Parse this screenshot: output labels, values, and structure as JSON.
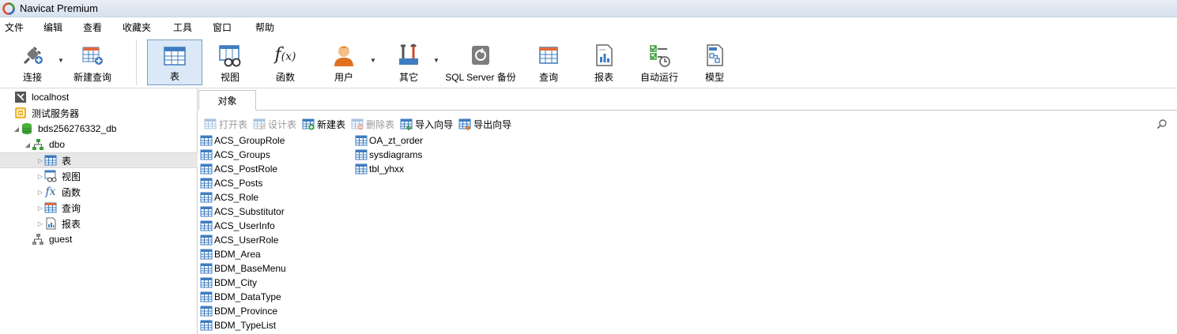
{
  "window": {
    "title": "Navicat Premium"
  },
  "menu": [
    "文件",
    "编辑",
    "查看",
    "收藏夹",
    "工具",
    "窗口",
    "帮助"
  ],
  "toolbar": {
    "connect": "连接",
    "new_query": "新建查询",
    "table": "表",
    "view": "视图",
    "function": "函数",
    "user": "用户",
    "other": "其它",
    "backup": "SQL Server 备份",
    "query": "查询",
    "report": "报表",
    "automation": "自动运行",
    "model": "模型"
  },
  "tree": {
    "localhost": "localhost",
    "test_server": "测试服务器",
    "db": "bds256276332_db",
    "schema_dbo": "dbo",
    "tables": "表",
    "views": "视图",
    "functions": "函数",
    "queries": "查询",
    "reports": "报表",
    "schema_guest": "guest"
  },
  "tabs": {
    "objects": "对象"
  },
  "objbar": {
    "open_table": "打开表",
    "design_table": "设计表",
    "new_table": "新建表",
    "delete_table": "删除表",
    "import_wizard": "导入向导",
    "export_wizard": "导出向导"
  },
  "objects": {
    "col1": [
      "ACS_GroupRole",
      "ACS_Groups",
      "ACS_PostRole",
      "ACS_Posts",
      "ACS_Role",
      "ACS_Substitutor",
      "ACS_UserInfo",
      "ACS_UserRole",
      "BDM_Area",
      "BDM_BaseMenu",
      "BDM_City",
      "BDM_DataType",
      "BDM_Province",
      "BDM_TypeList"
    ],
    "col2": [
      "OA_zt_order",
      "sysdiagrams",
      "tbl_yhxx"
    ]
  },
  "colors": {
    "selected_toolbar_bg": "#dbe8f7",
    "selected_toolbar_border": "#7a9cc6",
    "table_icon_blue": "#3f7cbf"
  }
}
